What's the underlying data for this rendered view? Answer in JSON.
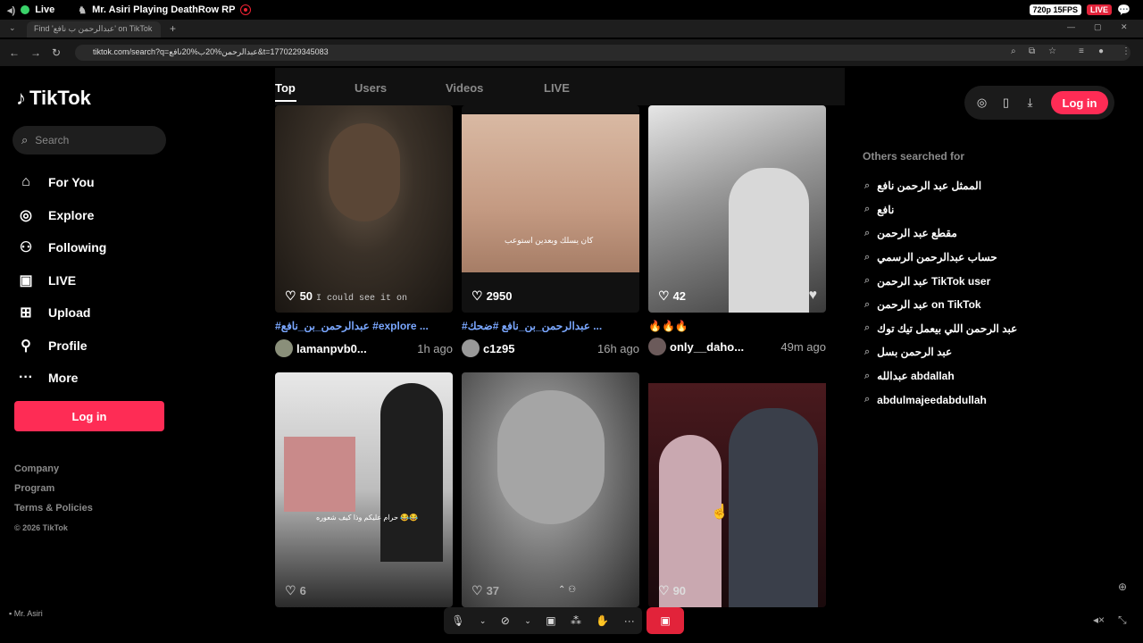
{
  "stream": {
    "live_label": "Live",
    "title": "Mr. Asiri Playing DeathRow RP",
    "quality": "720p 15FPS",
    "live_badge": "LIVE",
    "streamer": "Mr. Asiri"
  },
  "browser": {
    "tab_title": "Find 'عبدالرحمن ب نافع' on TikTok",
    "url": "tiktok.com/search?q=عبدالرحمن%20ب%20نافع&t=1770229345083"
  },
  "brand": {
    "name": "TikTok"
  },
  "search": {
    "placeholder": "Search"
  },
  "nav": [
    {
      "label": "For You",
      "icon": "home-icon"
    },
    {
      "label": "Explore",
      "icon": "compass-icon"
    },
    {
      "label": "Following",
      "icon": "following-icon"
    },
    {
      "label": "LIVE",
      "icon": "live-icon"
    },
    {
      "label": "Upload",
      "icon": "upload-icon"
    },
    {
      "label": "Profile",
      "icon": "profile-icon"
    },
    {
      "label": "More",
      "icon": "more-icon"
    }
  ],
  "sidebar_login": "Log in",
  "footer": {
    "company": "Company",
    "program": "Program",
    "terms": "Terms & Policies",
    "copyright": "© 2026 TikTok"
  },
  "tabs": {
    "top": "Top",
    "users": "Users",
    "videos": "Videos",
    "live": "LIVE"
  },
  "videos": [
    {
      "likes": "50",
      "overlay": "I could see it on",
      "caption": "#عبدالرحمن_بن_نافع #explore ...",
      "user": "lamanpvb0...",
      "time": "1h ago"
    },
    {
      "likes": "2950",
      "overlay": "كان يسلك وبعدين استوعب",
      "caption": "#عبدالرحمن_بن_نافع #ضحك ...",
      "user": "c1z95",
      "time": "16h ago"
    },
    {
      "likes": "42",
      "overlay": "",
      "caption": "🔥🔥🔥",
      "user": "only__daho...",
      "time": "49m ago"
    },
    {
      "likes": "6",
      "overlay": "حرام عليكم وذا كيف شعوره 😂😂",
      "caption": "",
      "user": "",
      "time": ""
    },
    {
      "likes": "37",
      "overlay": "",
      "caption": "",
      "user": "",
      "time": ""
    },
    {
      "likes": "90",
      "overlay": "",
      "caption": "",
      "user": "",
      "time": ""
    }
  ],
  "top_login": "Log in",
  "others_title": "Others searched for",
  "others": [
    "الممثل عبد الرحمن نافع",
    "نافع",
    "مقطع عبد الرحمن",
    "حساب عبدالرحمن الرسمي",
    "عبد الرحمن TikTok user",
    "عبد الرحمن on TikTok",
    "عبد الرحمن اللي بيعمل تيك توك",
    "عبد الرحمن بسل",
    "عبدالله abdallah",
    "abdulmajeedabdullah"
  ],
  "colors": {
    "accent": "#fe2c55",
    "caption_link": "#7aa7ff",
    "live_red": "#e2233a"
  }
}
